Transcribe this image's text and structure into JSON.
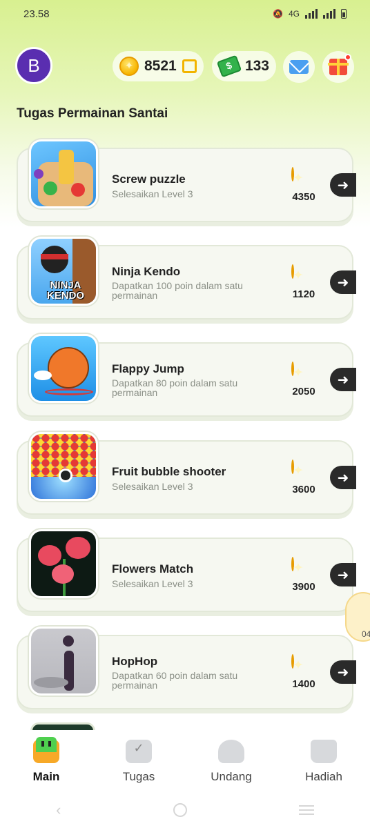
{
  "status_bar": {
    "time": "23.58",
    "network": "4G"
  },
  "header": {
    "avatar_letter": "B",
    "coins": "8521",
    "cash": "133"
  },
  "section_title": "Tugas Permainan Santai",
  "games": [
    {
      "title": "Screw puzzle",
      "subtitle": "Selesaikan Level 3",
      "reward": "4350",
      "icon": "screw-puzzle-thumbnail"
    },
    {
      "title": "Ninja Kendo",
      "subtitle": "Dapatkan 100 poin dalam satu permainan",
      "reward": "1120",
      "icon": "ninja-kendo-thumbnail",
      "thumb_text": "NINJA KENDO"
    },
    {
      "title": "Flappy Jump",
      "subtitle": "Dapatkan 80 poin dalam satu permainan",
      "reward": "2050",
      "icon": "flappy-jump-thumbnail"
    },
    {
      "title": "Fruit bubble shooter",
      "subtitle": "Selesaikan Level 3",
      "reward": "3600",
      "icon": "fruit-bubble-shooter-thumbnail"
    },
    {
      "title": "Flowers Match",
      "subtitle": "Selesaikan Level 3",
      "reward": "3900",
      "icon": "flowers-match-thumbnail"
    },
    {
      "title": "HopHop",
      "subtitle": "Dapatkan 60 poin dalam satu permainan",
      "reward": "1400",
      "icon": "hophop-thumbnail"
    }
  ],
  "floating_widget": {
    "text": "04"
  },
  "bottom_nav": [
    {
      "label": "Main",
      "active": true
    },
    {
      "label": "Tugas",
      "active": false
    },
    {
      "label": "Undang",
      "active": false
    },
    {
      "label": "Hadiah",
      "active": false
    }
  ],
  "colors": {
    "accent_green": "#d8f090",
    "avatar": "#5a2eb0",
    "coin": "#f7b500",
    "arrow_button": "#2a2a2a"
  }
}
